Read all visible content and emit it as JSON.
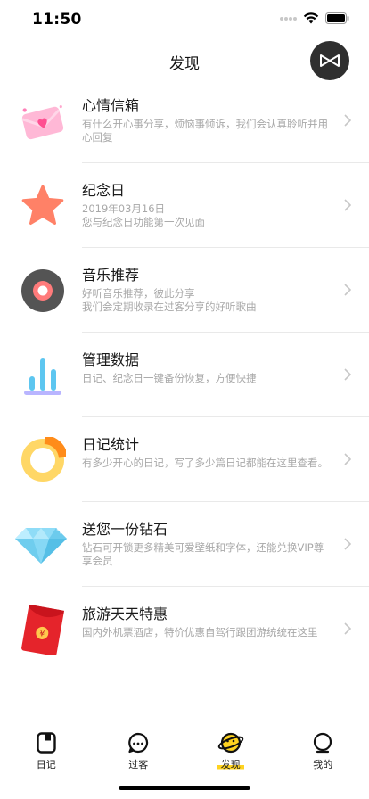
{
  "status": {
    "time": "11:50"
  },
  "header": {
    "title": "发现",
    "fab_icon": "brand-logo-icon"
  },
  "items": [
    {
      "title": "心情信箱",
      "desc": "有什么开心事分享，烦恼事倾诉，我们会认真聆听并用心回复",
      "icon": "mood-mailbox-icon"
    },
    {
      "title": "纪念日",
      "desc": "2019年03月16日\n您与纪念日功能第一次见面",
      "icon": "star-icon"
    },
    {
      "title": "音乐推荐",
      "desc": "好听音乐推荐，彼此分享\n我们会定期收录在过客分享的好听歌曲",
      "icon": "vinyl-record-icon"
    },
    {
      "title": "管理数据",
      "desc": "日记、纪念日一键备份恢复，方便快捷",
      "icon": "bar-chart-icon"
    },
    {
      "title": "日记统计",
      "desc": "有多少开心的日记，写了多少篇日记都能在这里查看。",
      "icon": "donut-chart-icon"
    },
    {
      "title": "送您一份钻石",
      "desc": "钻石可开锁更多精美可爱壁纸和字体，还能兑换VIP尊享会员",
      "icon": "diamond-icon"
    },
    {
      "title": "旅游天天特惠",
      "desc": "国内外机票酒店，特价优惠自驾行跟团游统统在这里",
      "icon": "red-envelope-icon"
    }
  ],
  "tabs": [
    {
      "label": "日记",
      "icon": "diary-icon"
    },
    {
      "label": "过客",
      "icon": "chat-bubble-icon"
    },
    {
      "label": "发现",
      "icon": "planet-icon",
      "active": true
    },
    {
      "label": "我的",
      "icon": "profile-icon"
    }
  ],
  "colors": {
    "accent": "#ffd320",
    "fab": "#2f2f2f"
  }
}
